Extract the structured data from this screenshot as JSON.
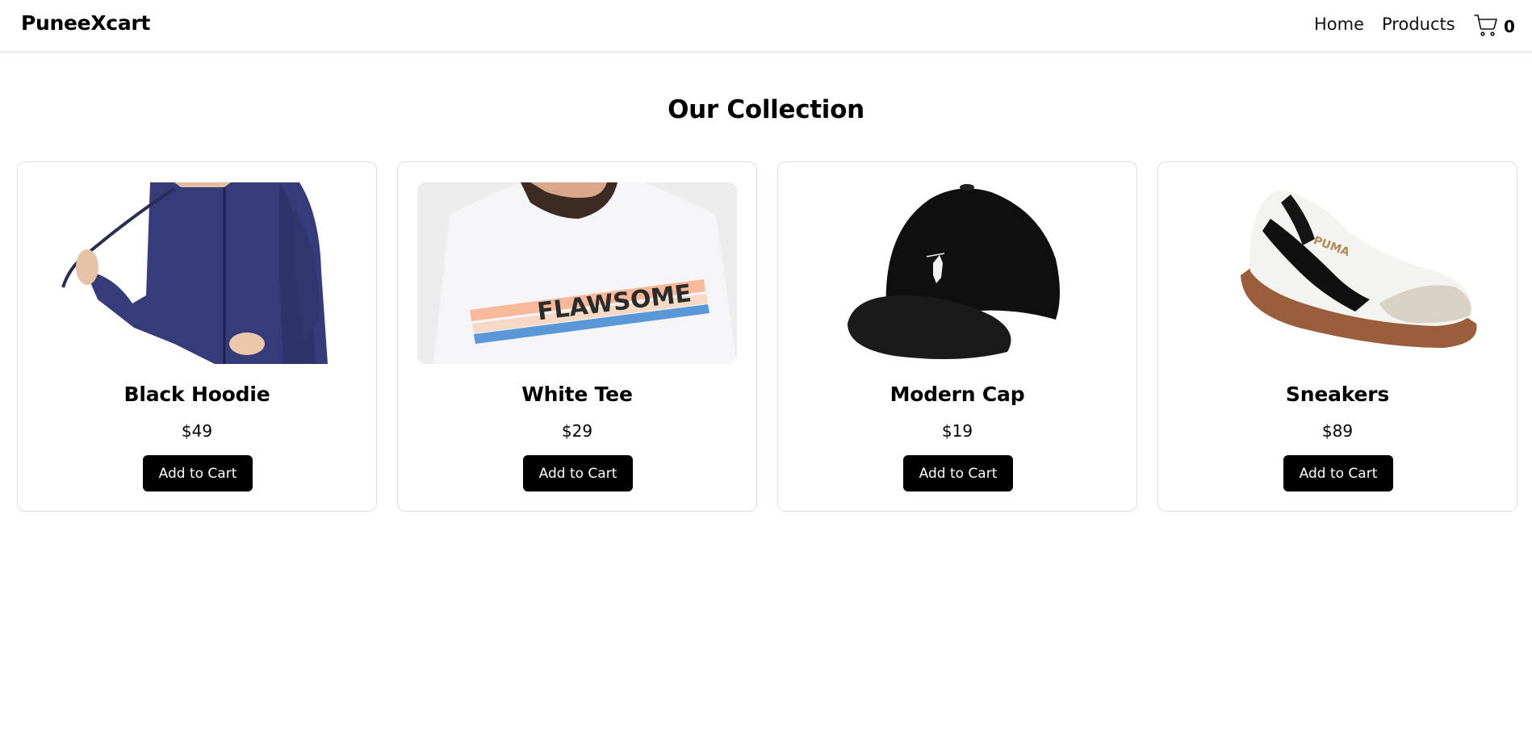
{
  "navbar": {
    "brand": "PuneeXcart",
    "links": [
      "Home",
      "Products"
    ],
    "cart_icon": "cart-icon",
    "cart_count": "0"
  },
  "main": {
    "heading": "Our Collection",
    "products": [
      {
        "name": "Black Hoodie",
        "price": "$49",
        "button": "Add to Cart",
        "image": "hoodie-photo"
      },
      {
        "name": "White Tee",
        "price": "$29",
        "button": "Add to Cart",
        "image": "tshirt-photo",
        "image_text": "FLAWSOME"
      },
      {
        "name": "Modern Cap",
        "price": "$19",
        "button": "Add to Cart",
        "image": "cap-photo"
      },
      {
        "name": "Sneakers",
        "price": "$89",
        "button": "Add to Cart",
        "image": "sneaker-photo",
        "image_text": "PUMA"
      }
    ]
  },
  "colors": {
    "button_bg": "#000000",
    "button_text": "#ffffff",
    "border": "#dedede"
  }
}
